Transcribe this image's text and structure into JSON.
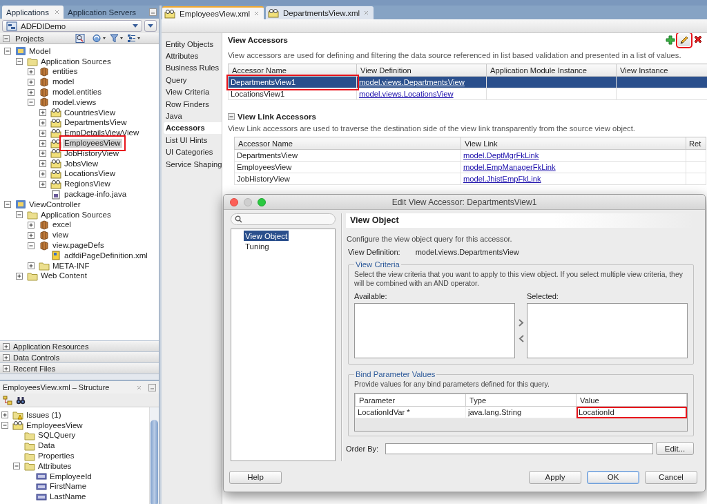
{
  "navigator": {
    "tabs": [
      {
        "label": "Applications",
        "selected": true
      },
      {
        "label": "Application Servers",
        "selected": false
      }
    ],
    "application": "ADFDIDemo",
    "projects_title": "Projects",
    "projects_tree": [
      {
        "label": "Model",
        "kind": "project",
        "expanded": true,
        "selected": false,
        "highlighted": false,
        "children": [
          {
            "label": "Application Sources",
            "kind": "folder",
            "expanded": true,
            "selected": false,
            "highlighted": false,
            "children": [
              {
                "label": "entities",
                "kind": "package",
                "expanded": false,
                "selected": false,
                "highlighted": false
              },
              {
                "label": "model",
                "kind": "package",
                "expanded": false,
                "selected": false,
                "highlighted": false
              },
              {
                "label": "model.entities",
                "kind": "package",
                "expanded": false,
                "selected": false,
                "highlighted": false
              },
              {
                "label": "model.views",
                "kind": "package",
                "expanded": true,
                "selected": false,
                "highlighted": false,
                "children": [
                  {
                    "label": "CountriesView",
                    "kind": "viewobj",
                    "expanded": false,
                    "selected": false,
                    "highlighted": false
                  },
                  {
                    "label": "DepartmentsView",
                    "kind": "viewobj",
                    "expanded": false,
                    "selected": false,
                    "highlighted": false
                  },
                  {
                    "label": "EmpDetailsViewView",
                    "kind": "viewobj",
                    "expanded": false,
                    "selected": false,
                    "highlighted": false
                  },
                  {
                    "label": "EmployeesView",
                    "kind": "viewobj",
                    "expanded": false,
                    "selected": true,
                    "highlighted": true
                  },
                  {
                    "label": "JobHistoryView",
                    "kind": "viewobj",
                    "expanded": false,
                    "selected": false,
                    "highlighted": false
                  },
                  {
                    "label": "JobsView",
                    "kind": "viewobj",
                    "expanded": false,
                    "selected": false,
                    "highlighted": false
                  },
                  {
                    "label": "LocationsView",
                    "kind": "viewobj",
                    "expanded": false,
                    "selected": false,
                    "highlighted": false
                  },
                  {
                    "label": "RegionsView",
                    "kind": "viewobj",
                    "expanded": false,
                    "selected": false,
                    "highlighted": false
                  },
                  {
                    "label": "package-info.java",
                    "kind": "java",
                    "selected": false,
                    "highlighted": false
                  }
                ]
              }
            ]
          }
        ]
      },
      {
        "label": "ViewController",
        "kind": "project",
        "expanded": true,
        "selected": false,
        "highlighted": false,
        "children": [
          {
            "label": "Application Sources",
            "kind": "folder",
            "expanded": true,
            "selected": false,
            "highlighted": false,
            "children": [
              {
                "label": "excel",
                "kind": "package",
                "expanded": false,
                "selected": false,
                "highlighted": false
              },
              {
                "label": "view",
                "kind": "package",
                "expanded": false,
                "selected": false,
                "highlighted": false
              },
              {
                "label": "view.pageDefs",
                "kind": "package",
                "expanded": true,
                "selected": false,
                "highlighted": false,
                "children": [
                  {
                    "label": "adfdiPageDefinition.xml",
                    "kind": "pagedef",
                    "selected": false,
                    "highlighted": false
                  }
                ]
              },
              {
                "label": "META-INF",
                "kind": "folder",
                "expanded": false,
                "selected": false,
                "highlighted": false
              }
            ]
          },
          {
            "label": "Web Content",
            "kind": "folder",
            "expanded": false,
            "selected": false,
            "highlighted": false
          }
        ]
      }
    ]
  },
  "accordions": [
    {
      "label": "Application Resources",
      "expanded": false
    },
    {
      "label": "Data Controls",
      "expanded": false
    },
    {
      "label": "Recent Files",
      "expanded": false
    }
  ],
  "structure": {
    "title": "EmployeesView.xml – Structure",
    "tree": [
      {
        "label": "Issues (1)",
        "kind": "issues",
        "expanded": false
      },
      {
        "label": "EmployeesView",
        "kind": "viewobj",
        "expanded": true,
        "children": [
          {
            "label": "SQLQuery",
            "kind": "folder"
          },
          {
            "label": "Data",
            "kind": "folder"
          },
          {
            "label": "Properties",
            "kind": "folder"
          },
          {
            "label": "Attributes",
            "kind": "folder",
            "expanded": true,
            "children": [
              {
                "label": "EmployeeId",
                "kind": "attribute"
              },
              {
                "label": "FirstName",
                "kind": "attribute"
              },
              {
                "label": "LastName",
                "kind": "attribute"
              }
            ]
          }
        ]
      }
    ]
  },
  "editor": {
    "tabs": [
      {
        "label": "EmployeesView.xml",
        "selected": true
      },
      {
        "label": "DepartmentsView.xml",
        "selected": false
      }
    ],
    "sections": [
      {
        "label": "Entity Objects",
        "selected": false
      },
      {
        "label": "Attributes",
        "selected": false
      },
      {
        "label": "Business Rules",
        "selected": false
      },
      {
        "label": "Query",
        "selected": false
      },
      {
        "label": "View Criteria",
        "selected": false
      },
      {
        "label": "Row Finders",
        "selected": false
      },
      {
        "label": "Java",
        "selected": false
      },
      {
        "label": "Accessors",
        "selected": true
      },
      {
        "label": "List UI Hints",
        "selected": false
      },
      {
        "label": "UI Categories",
        "selected": false
      },
      {
        "label": "Service Shaping",
        "selected": false
      }
    ],
    "view_accessors": {
      "title": "View Accessors",
      "toolbar": [
        {
          "kind": "add",
          "highlighted": false
        },
        {
          "kind": "edit",
          "highlighted": true
        },
        {
          "kind": "delete",
          "highlighted": false
        }
      ],
      "description": "View accessors are used for defining and filtering the data source referenced in list based validation and presented in a list of values.",
      "columns": [
        {
          "label": "Accessor Name",
          "kind": "text"
        },
        {
          "label": "View Definition",
          "kind": "link"
        },
        {
          "label": "Application Module Instance"
        },
        {
          "label": "View Instance"
        }
      ],
      "rows": [
        {
          "cells": [
            "DepartmentsView1",
            "model.views.DepartmentsView"
          ],
          "selected": true,
          "highlighted": true
        },
        {
          "cells": [
            "LocationsView1",
            "model.views.LocationsView"
          ],
          "selected": false,
          "highlighted": false
        }
      ]
    },
    "view_link_accessors": {
      "title": "View Link Accessors",
      "expanded": true,
      "description": "View Link accessors are used to traverse the destination side of the view link transparently from the source view object.",
      "columns": [
        {
          "label": "Accessor Name",
          "kind": "text"
        },
        {
          "label": "View Link",
          "kind": "link"
        },
        {
          "label": "Ret"
        }
      ],
      "rows": [
        {
          "cells": [
            "DepartmentsView",
            "model.DeptMgrFkLink"
          ]
        },
        {
          "cells": [
            "EmployeesView",
            "model.EmpManagerFkLink"
          ]
        },
        {
          "cells": [
            "JobHistoryView",
            "model.JhistEmpFkLink"
          ]
        }
      ]
    }
  },
  "dialog": {
    "title": "Edit View Accessor: DepartmentsView1",
    "pages": [
      {
        "label": "View Object",
        "selected": true
      },
      {
        "label": "Tuning",
        "selected": false
      }
    ],
    "page_title": "View Object",
    "intro": "Configure the view object query for this accessor.",
    "view_definition_label": "View Definition:",
    "view_definition": "model.views.DepartmentsView",
    "view_criteria": {
      "title": "View Criteria",
      "description": "Select the view criteria that you want to apply to this view object. If you select multiple view criteria, they will be combined with an AND operator.",
      "available_label": "Available:",
      "selected_label": "Selected:"
    },
    "bind_parameters": {
      "title": "Bind Parameter Values",
      "description": "Provide values for any bind parameters defined for this query.",
      "columns": [
        "Parameter",
        "Type",
        "Value"
      ],
      "rows": [
        {
          "cells": [
            {
              "text": "LocationIdVar *",
              "highlighted": false
            },
            {
              "text": "java.lang.String",
              "highlighted": false
            },
            {
              "text": "LocationId",
              "highlighted": true
            }
          ]
        }
      ]
    },
    "order_by": {
      "label": "Order By:",
      "button": "Edit..."
    },
    "help_button": "Help",
    "buttons": [
      {
        "label": "Apply",
        "default": false
      },
      {
        "label": "OK",
        "default": true
      },
      {
        "label": "Cancel",
        "default": false
      }
    ]
  }
}
